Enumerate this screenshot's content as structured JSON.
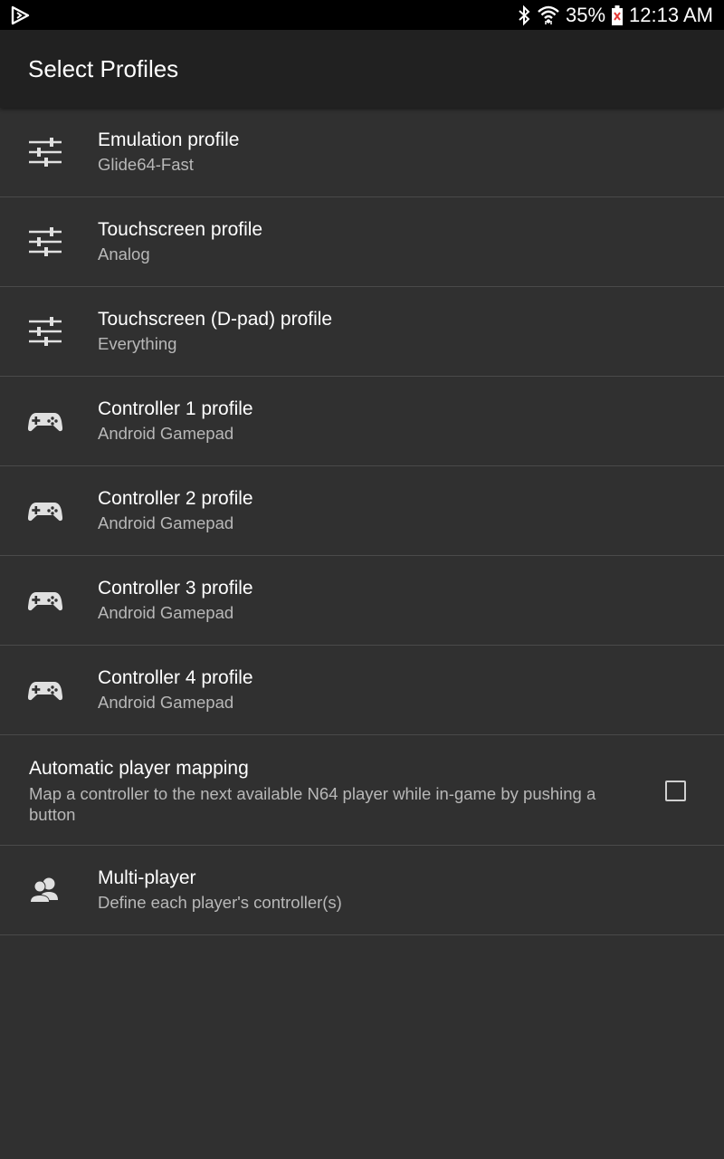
{
  "status_bar": {
    "app_icon": "play-store-icon",
    "icons": [
      "bluetooth-icon",
      "wifi-icon",
      "battery-icon"
    ],
    "battery_percent": "35%",
    "time": "12:13 AM"
  },
  "app_bar": {
    "title": "Select Profiles"
  },
  "items": [
    {
      "icon": "sliders-icon",
      "title": "Emulation profile",
      "subtitle": "Glide64-Fast"
    },
    {
      "icon": "sliders-icon",
      "title": "Touchscreen profile",
      "subtitle": "Analog"
    },
    {
      "icon": "sliders-icon",
      "title": "Touchscreen (D-pad) profile",
      "subtitle": "Everything"
    },
    {
      "icon": "gamepad-icon",
      "title": "Controller 1 profile",
      "subtitle": "Android Gamepad"
    },
    {
      "icon": "gamepad-icon",
      "title": "Controller 2 profile",
      "subtitle": "Android Gamepad"
    },
    {
      "icon": "gamepad-icon",
      "title": "Controller 3 profile",
      "subtitle": "Android Gamepad"
    },
    {
      "icon": "gamepad-icon",
      "title": "Controller 4 profile",
      "subtitle": "Android Gamepad"
    }
  ],
  "auto_mapping": {
    "title": "Automatic player mapping",
    "subtitle": "Map a controller to the next available N64 player while in-game by pushing a button",
    "checked": false
  },
  "multiplayer": {
    "icon": "multiplayer-icon",
    "title": "Multi-player",
    "subtitle": "Define each player's controller(s)"
  },
  "colors": {
    "background": "#303030",
    "app_bar": "#212121",
    "status_bar": "#000000",
    "divider": "#4a4a4a",
    "primary_text": "#ffffff",
    "secondary_text": "#b8b8b8"
  }
}
